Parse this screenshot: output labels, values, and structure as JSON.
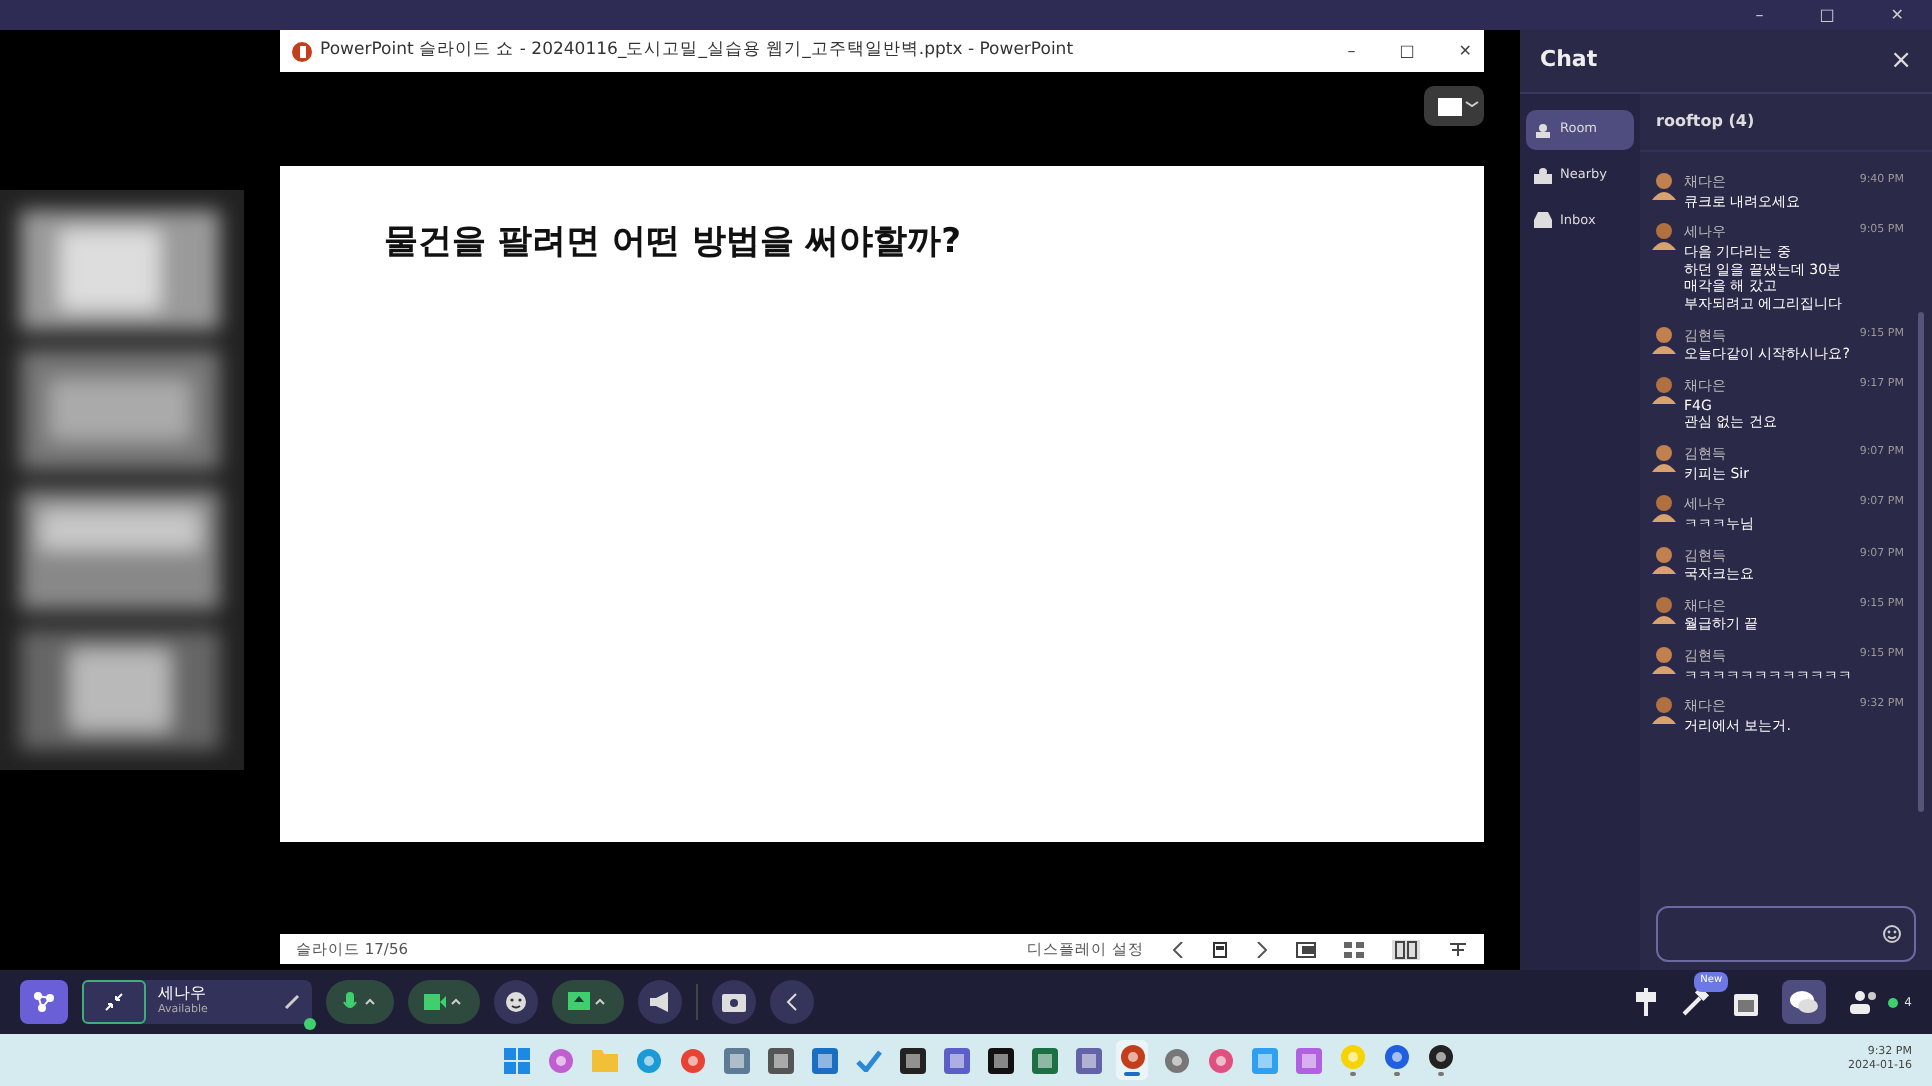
{
  "app": {
    "window_controls": [
      "–",
      "□",
      "✕"
    ]
  },
  "presentation": {
    "title": "PowerPoint 슬라이드 쇼  -  20240116_도시고밀_실습용 웹기_고주택일반벽.pptx  -  PowerPoint",
    "window_controls": [
      "–",
      "□",
      "✕"
    ],
    "slide_title": "물건을 팔려면 어떤 방법을 써야할까?",
    "status": "슬라이드 17/56",
    "display_settings": "디스플레이 설정"
  },
  "chat": {
    "title": "Chat",
    "close": "×",
    "nav": [
      {
        "label": "Room",
        "selected": true
      },
      {
        "label": "Nearby",
        "selected": false
      },
      {
        "label": "Inbox",
        "selected": false
      }
    ],
    "room": "rooftop (4)",
    "messages": [
      {
        "name": "채다은",
        "time": "9:40 PM",
        "lines": [
          "큐크로 내려오세요"
        ]
      },
      {
        "name": "세나우",
        "time": "9:05 PM",
        "lines": [
          "다음 기다리는 중",
          "하던 일을 끝냈는데 30분",
          "매각을 해 갔고",
          "부자되려고 에그리집니다"
        ]
      },
      {
        "name": "김현득",
        "time": "9:15 PM",
        "lines": [
          "오늘다같이 시작하시나요?"
        ]
      },
      {
        "name": "채다은",
        "time": "9:17 PM",
        "lines": [
          "F4G",
          "관심 없는 건요"
        ]
      },
      {
        "name": "김현득",
        "time": "9:07 PM",
        "lines": [
          "키피는 Sir"
        ]
      },
      {
        "name": "세나우",
        "time": "9:07 PM",
        "lines": [
          "ㅋㅋㅋ누님"
        ]
      },
      {
        "name": "김현득",
        "time": "9:07 PM",
        "lines": [
          "국자크는요"
        ]
      },
      {
        "name": "채다은",
        "time": "9:15 PM",
        "lines": [
          "월급하기 끝"
        ]
      },
      {
        "name": "김현득",
        "time": "9:15 PM",
        "lines": [
          "ㅋㅋㅋㅋㅋㅋㅋㅋㅋㅋㅋㅋ"
        ]
      },
      {
        "name": "채다은",
        "time": "9:32 PM",
        "lines": [
          "거리에서 보는거."
        ]
      }
    ]
  },
  "toolbar": {
    "user_name": "세나우",
    "user_status": "Available",
    "new_badge": "New",
    "participants": "4"
  },
  "taskbar": {
    "apps": [
      {
        "active": false,
        "running": false
      },
      {
        "active": false,
        "running": false
      },
      {
        "active": false,
        "running": false
      },
      {
        "active": false,
        "running": false
      },
      {
        "active": false,
        "running": false
      },
      {
        "active": false,
        "running": false
      },
      {
        "active": false,
        "running": false
      },
      {
        "active": false,
        "running": false
      },
      {
        "active": false,
        "running": false
      },
      {
        "active": false,
        "running": false
      },
      {
        "active": false,
        "running": false
      },
      {
        "active": false,
        "running": false
      },
      {
        "active": false,
        "running": false
      },
      {
        "active": false,
        "running": false
      },
      {
        "active": true,
        "running": true
      },
      {
        "active": false,
        "running": false
      },
      {
        "active": false,
        "running": false
      },
      {
        "active": false,
        "running": false
      },
      {
        "active": false,
        "running": false
      },
      {
        "active": false,
        "running": true
      },
      {
        "active": false,
        "running": true
      },
      {
        "active": false,
        "running": true
      }
    ],
    "time": "9:32 PM",
    "date": "2024-01-16"
  }
}
